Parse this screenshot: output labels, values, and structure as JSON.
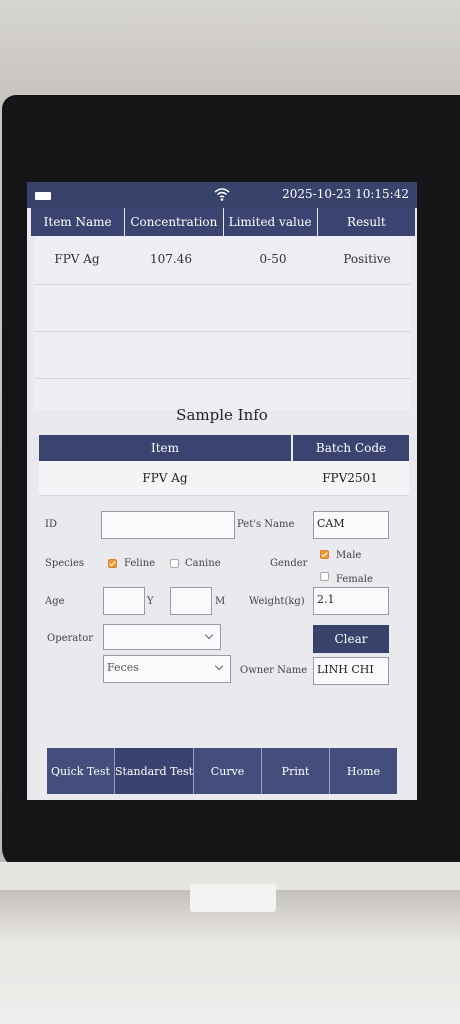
{
  "status": {
    "datetime": "2025-10-23 10:15:42"
  },
  "results": {
    "headers": [
      "Item Name",
      "Concentration",
      "Limited value",
      "Result"
    ],
    "rows": [
      {
        "item": "FPV Ag",
        "concentration": "107.46",
        "limit": "0-50",
        "result": "Positive"
      }
    ]
  },
  "sample": {
    "title": "Sample Info",
    "headers": [
      "Item",
      "Batch Code"
    ],
    "item": "FPV Ag",
    "batch_code": "FPV2501"
  },
  "form": {
    "id_label": "ID",
    "id_value": "",
    "pet_name_label": "Pet's Name",
    "pet_name_value": "CAM",
    "species_label": "Species",
    "feline_label": "Feline",
    "canine_label": "Canine",
    "gender_label": "Gender",
    "male_label": "Male",
    "female_label": "Female",
    "age_label": "Age",
    "age_years": "",
    "age_y_unit": "Y",
    "age_months": "",
    "age_m_unit": "M",
    "weight_label": "Weight(kg)",
    "weight_value": "2.1",
    "operator_label": "Operator",
    "operator_value": "",
    "clear_label": "Clear",
    "sample_type_value": "Feces",
    "owner_label": "Owner Name",
    "owner_value": "LINH CHI"
  },
  "nav": {
    "quick_test": "Quick Test",
    "standard_test": "Standard Test",
    "curve": "Curve",
    "print": "Print",
    "home": "Home"
  },
  "colors": {
    "header_bg": "#3b4470",
    "checkbox_checked": "#e89a3c"
  }
}
